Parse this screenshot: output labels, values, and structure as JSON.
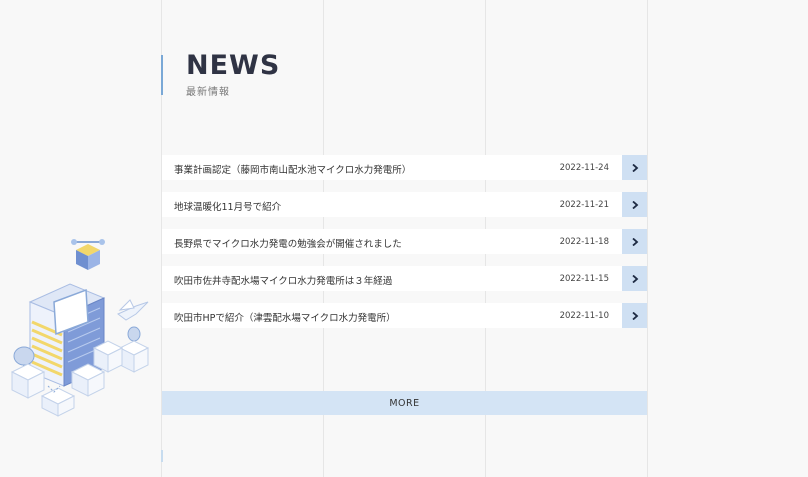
{
  "header": {
    "title": "NEWS",
    "subtitle": "最新情報"
  },
  "news": [
    {
      "text": "事業計画認定（藤岡市南山配水池マイクロ水力発電所）",
      "date": "2022-11-24"
    },
    {
      "text": "地球温暖化11月号で紹介",
      "date": "2022-11-21"
    },
    {
      "text": "長野県でマイクロ水力発電の勉強会が開催されました",
      "date": "2022-11-18"
    },
    {
      "text": "吹田市佐井寺配水場マイクロ水力発電所は３年経過",
      "date": "2022-11-15"
    },
    {
      "text": "吹田市HPで紹介（津雲配水場マイクロ水力発電所）",
      "date": "2022-11-10"
    }
  ],
  "more_label": "MORE",
  "colors": {
    "accent": "#cfe0f3",
    "title": "#2f3344",
    "accent_bar": "#7aa8d6"
  },
  "icons": {
    "row_arrow": "chevron-right-icon",
    "illustration": "isometric-city-illustration"
  }
}
